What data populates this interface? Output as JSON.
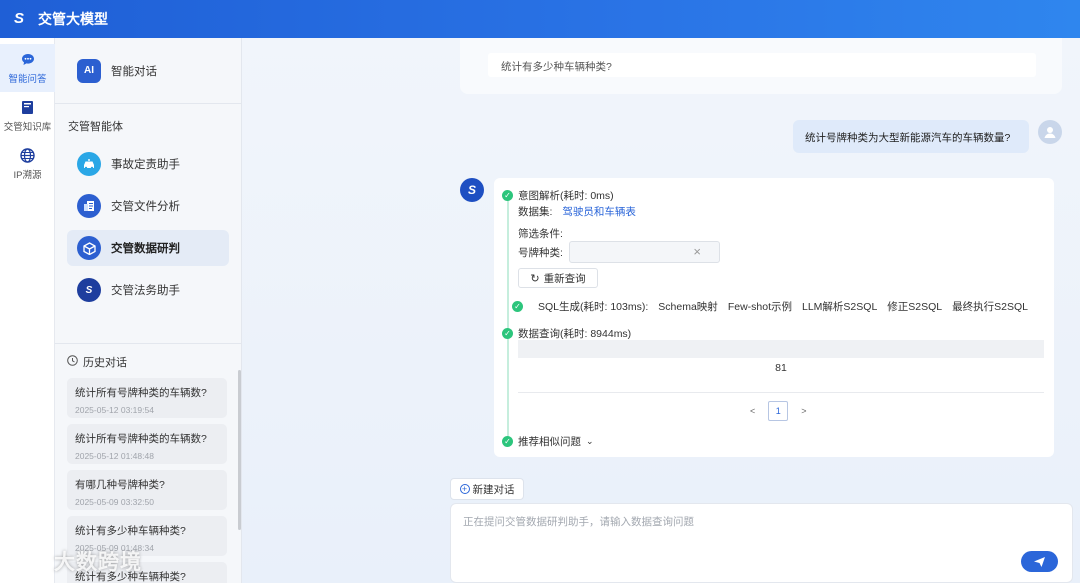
{
  "app": {
    "title": "交管大模型",
    "logo": "S"
  },
  "rail": [
    {
      "label": "智能问答",
      "icon": "chat-icon",
      "active": true
    },
    {
      "label": "交管知识库",
      "icon": "book-icon",
      "active": false
    },
    {
      "label": "IP溯源",
      "icon": "globe-icon",
      "active": false
    }
  ],
  "sidebar": {
    "top_item": {
      "label": "智能对话",
      "icon": "ai-icon"
    },
    "agents_title": "交管智能体",
    "agents": [
      {
        "label": "事故定责助手",
        "icon": "car-accident-icon",
        "color": "#2aa7e6"
      },
      {
        "label": "交管文件分析",
        "icon": "document-icon",
        "color": "#2c5fd0"
      },
      {
        "label": "交管数据研判",
        "icon": "cube-icon",
        "color": "#2c5fd0",
        "active": true
      },
      {
        "label": "交管法务助手",
        "icon": "law-icon",
        "color": "#1e3e9e"
      }
    ],
    "history_title": "历史对话",
    "history": [
      {
        "question": "统计所有号牌种类的车辆数?",
        "time": "2025-05-12 03:19:54"
      },
      {
        "question": "统计所有号牌种类的车辆数?",
        "time": "2025-05-12 01:48:48"
      },
      {
        "question": "有哪几种号牌种类?",
        "time": "2025-05-09 03:32:50"
      },
      {
        "question": "统计有多少种车辆种类?",
        "time": "2025-05-09 01:48:34"
      },
      {
        "question": "统计有多少种车辆种类?",
        "time": ""
      }
    ]
  },
  "conversation": {
    "previous_question": "统计有多少种车辆种类?",
    "user_question": "统计号牌种类为大型新能源汽车的车辆数量?",
    "answer": {
      "intent": {
        "title": "意图解析(耗时: 0ms)",
        "dataset_label": "数据集:",
        "dataset_value": "驾驶员和车辆表",
        "filter_label": "筛选条件:",
        "plate_label": "号牌种类:",
        "plate_value": "",
        "requery_label": "重新查询"
      },
      "sql": {
        "title": "SQL生成(耗时: 103ms):",
        "tags": [
          "Schema映射",
          "Few-shot示例",
          "LLM解析S2SQL",
          "修正S2SQL",
          "最终执行S2SQL"
        ]
      },
      "query": {
        "title": "数据查询(耗时: 8944ms)",
        "result": "81",
        "page": "1",
        "prev": "<",
        "next": ">"
      },
      "recommend": {
        "title": "推荐相似问题"
      }
    }
  },
  "composer": {
    "new_chat_label": "新建对话",
    "placeholder": "正在提问交管数据研判助手，请输入数据查询问题",
    "value": ""
  },
  "watermark": "大数跨境",
  "colors": {
    "primary": "#2b66d9",
    "success": "#2cc57c",
    "header": "#1f5fd6"
  }
}
